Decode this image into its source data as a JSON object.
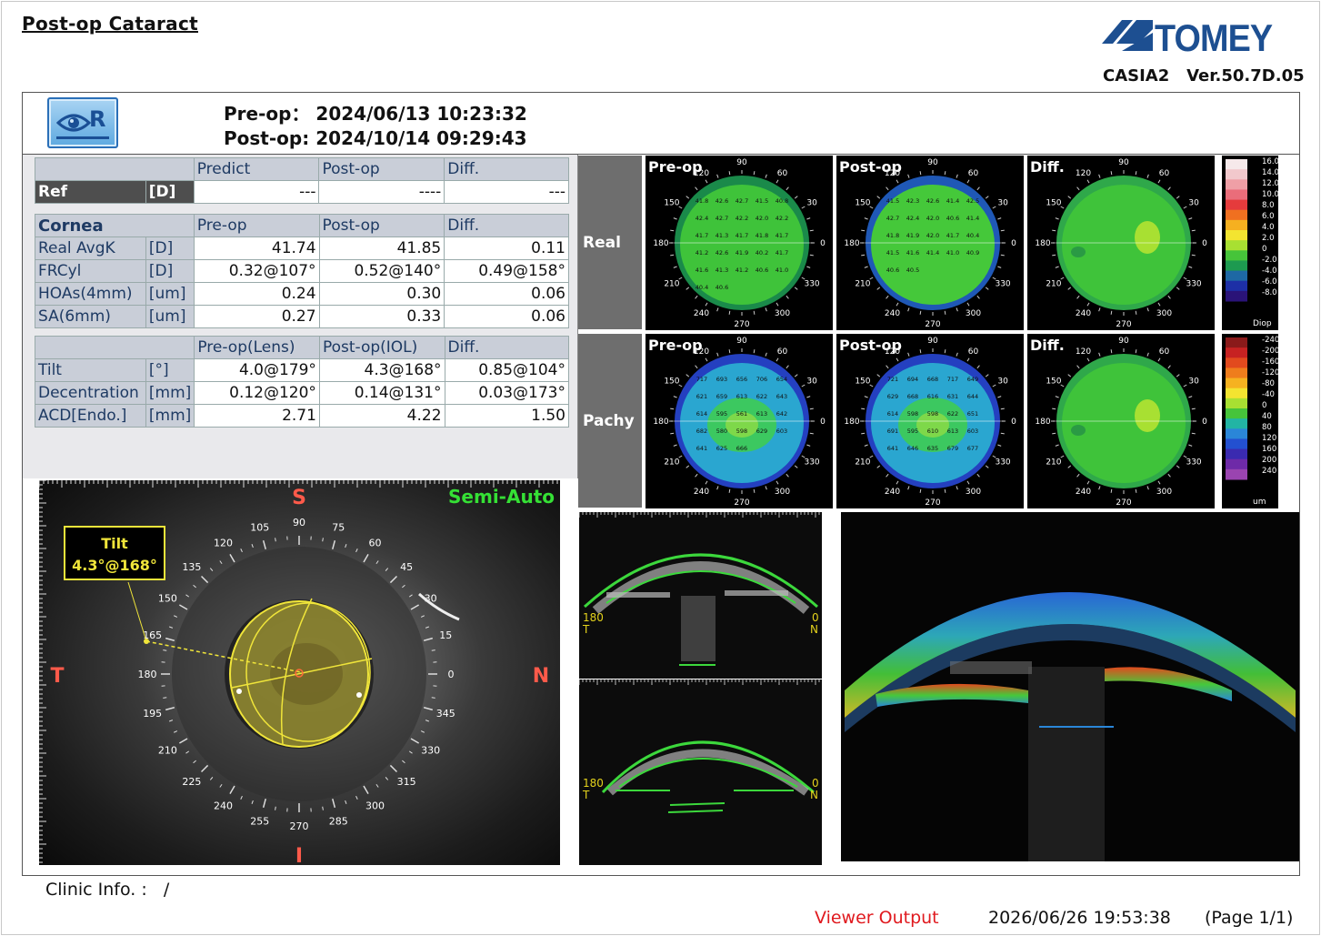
{
  "report": {
    "title": "Post-op Cataract",
    "brand": "TOMEY",
    "device": "CASIA2",
    "version": "Ver.50.7D.05"
  },
  "header": {
    "eye_label": "R",
    "preop_label": "Pre-op：",
    "preop_date": "2024/06/13 10:23:32",
    "postop_label": "Post-op:",
    "postop_date": "2024/10/14 09:29:43"
  },
  "ref_table": {
    "headers": [
      "Predict",
      "Post-op",
      "Diff."
    ],
    "row": {
      "label": "Ref",
      "unit": "[D]",
      "values": [
        "---",
        "----",
        "---"
      ]
    }
  },
  "cornea_table": {
    "section": "Cornea",
    "headers": [
      "Pre-op",
      "Post-op",
      "Diff."
    ],
    "rows": [
      {
        "label": "Real AvgK",
        "unit": "[D]",
        "values": [
          "41.74",
          "41.85",
          "0.11"
        ]
      },
      {
        "label": "FRCyl",
        "unit": "[D]",
        "values": [
          "0.32@107°",
          "0.52@140°",
          "0.49@158°"
        ]
      },
      {
        "label": "HOAs(4mm)",
        "unit": "[um]",
        "values": [
          "0.24",
          "0.30",
          "0.06"
        ]
      },
      {
        "label": "SA(6mm)",
        "unit": "[um]",
        "values": [
          "0.27",
          "0.33",
          "0.06"
        ]
      }
    ]
  },
  "lens_table": {
    "headers": [
      "Pre-op(Lens)",
      "Post-op(IOL)",
      "Diff."
    ],
    "rows": [
      {
        "label": "Tilt",
        "unit": "[°]",
        "values": [
          "4.0@179°",
          "4.3@168°",
          "0.85@104°"
        ]
      },
      {
        "label": "Decentration",
        "unit": "[mm]",
        "values": [
          "0.12@120°",
          "0.14@131°",
          "0.03@173°"
        ]
      },
      {
        "label": "ACD[Endo.]",
        "unit": "[mm]",
        "values": [
          "2.71",
          "4.22",
          "1.50"
        ]
      }
    ]
  },
  "maps": {
    "row_labels": [
      "Real",
      "Pachy"
    ],
    "col_titles": [
      "Pre-op",
      "Post-op",
      "Diff."
    ],
    "axis_labels": [
      "90",
      "60",
      "30",
      "0",
      "330",
      "300",
      "270",
      "240",
      "210",
      "180",
      "150",
      "120"
    ],
    "real_scale": {
      "unit": "Diop",
      "ticks": [
        "16.0",
        "14.0",
        "12.0",
        "10.0",
        "8.0",
        "6.0",
        "4.0",
        "2.0",
        "0",
        "-2.0",
        "-4.0",
        "-6.0",
        "-8.0"
      ],
      "colors": [
        "#f6e9ea",
        "#f2c8cc",
        "#ef9fa6",
        "#ea6d7a",
        "#e53b3c",
        "#f07020",
        "#f6b020",
        "#f3e430",
        "#a8e032",
        "#46c43a",
        "#1d9a50",
        "#1e68a4",
        "#1d2fa6",
        "#2a1378"
      ]
    },
    "pachy_scale": {
      "unit": "um",
      "ticks": [
        "-240",
        "-200",
        "-160",
        "-120",
        "-80",
        "-40",
        "0",
        "40",
        "80",
        "120",
        "160",
        "200",
        "240"
      ],
      "colors": [
        "#8a1a1a",
        "#c72222",
        "#e24a1e",
        "#ef7d1c",
        "#f6b220",
        "#f3e430",
        "#a8e032",
        "#46c43a",
        "#22b4a4",
        "#2a86d8",
        "#2350d0",
        "#3a2ab0",
        "#6e2aa8",
        "#9a44b0"
      ]
    },
    "preop_real_values": [
      "41.8",
      "42.6",
      "42.7",
      "41.5",
      "40.8",
      "42.4",
      "42.7",
      "42.2",
      "42.0",
      "42.2",
      "41.7",
      "41.3",
      "41.7",
      "41.8",
      "41.7",
      "41.2",
      "42.6",
      "41.9",
      "40.2",
      "41.7",
      "41.6",
      "41.3",
      "41.2",
      "40.6",
      "41.0",
      "40.4",
      "40.6"
    ],
    "postop_real_values": [
      "41.5",
      "42.3",
      "42.6",
      "41.4",
      "42.5",
      "42.7",
      "42.4",
      "42.0",
      "40.6",
      "41.4",
      "41.8",
      "41.9",
      "42.0",
      "41.7",
      "40.4",
      "41.5",
      "41.6",
      "41.4",
      "41.0",
      "40.9",
      "40.6",
      "40.5"
    ],
    "preop_pachy_values": [
      "717",
      "693",
      "656",
      "706",
      "654",
      "621",
      "659",
      "613",
      "622",
      "643",
      "614",
      "595",
      "561",
      "613",
      "642",
      "682",
      "580",
      "598",
      "629",
      "603",
      "641",
      "625",
      "666"
    ],
    "postop_pachy_values": [
      "721",
      "694",
      "668",
      "717",
      "649",
      "629",
      "668",
      "616",
      "631",
      "644",
      "614",
      "598",
      "598",
      "622",
      "651",
      "691",
      "595",
      "610",
      "613",
      "603",
      "641",
      "646",
      "635",
      "679",
      "677"
    ]
  },
  "eye_photo": {
    "mode": "Semi-Auto",
    "tilt_label": "Tilt",
    "tilt_value": "4.3°@168°",
    "directions": {
      "superior": "S",
      "inferior": "I",
      "temporal": "T",
      "nasal": "N"
    },
    "angles": [
      "105",
      "90",
      "75",
      "120",
      "60",
      "135",
      "45",
      "150",
      "30",
      "165",
      "15",
      "180",
      "0",
      "195",
      "345",
      "210",
      "330",
      "225",
      "315",
      "240",
      "300",
      "255",
      "270",
      "285"
    ]
  },
  "oct": {
    "top": {
      "left_angle": "180",
      "left_side": "T",
      "right_angle": "0",
      "right_side": "N"
    },
    "bottom": {
      "left_angle": "180",
      "left_side": "T",
      "right_angle": "0",
      "right_side": "N"
    }
  },
  "footer": {
    "clinic_label": "Clinic Info. :",
    "clinic_value": "/",
    "viewer_output": "Viewer Output",
    "print_date": "2026/06/26 19:53:38",
    "page": "(Page 1/1)"
  }
}
